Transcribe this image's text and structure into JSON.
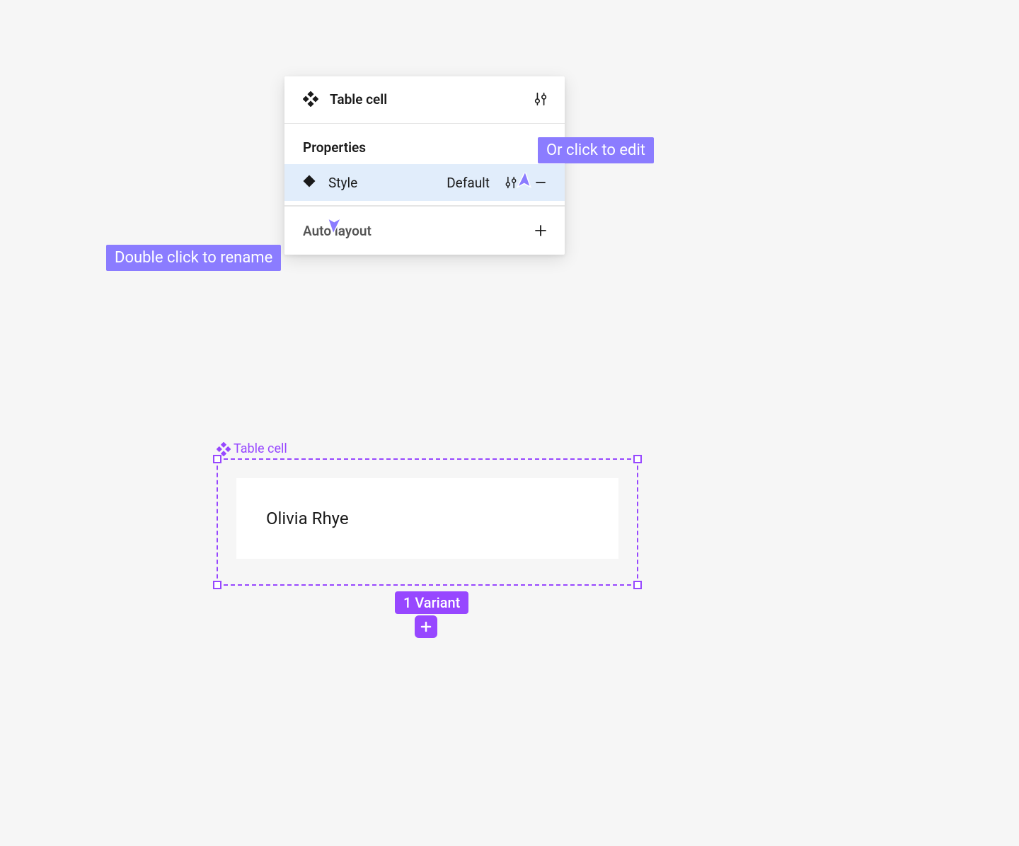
{
  "panel": {
    "component_name": "Table cell",
    "properties_section_title": "Properties",
    "property": {
      "name": "Style",
      "value": "Default"
    },
    "auto_layout_label": "Auto layout"
  },
  "tooltips": {
    "rename": "Double click to rename",
    "edit": "Or click to edit"
  },
  "canvas": {
    "component_label": "Table cell",
    "cell_text": "Olivia Rhye",
    "variant_badge": "1 Variant"
  },
  "icons": {
    "component_set": "component-set-icon",
    "sliders": "sliders-icon",
    "variant_diamond": "variant-diamond-icon",
    "minus": "minus-icon",
    "plus": "plus-icon"
  }
}
